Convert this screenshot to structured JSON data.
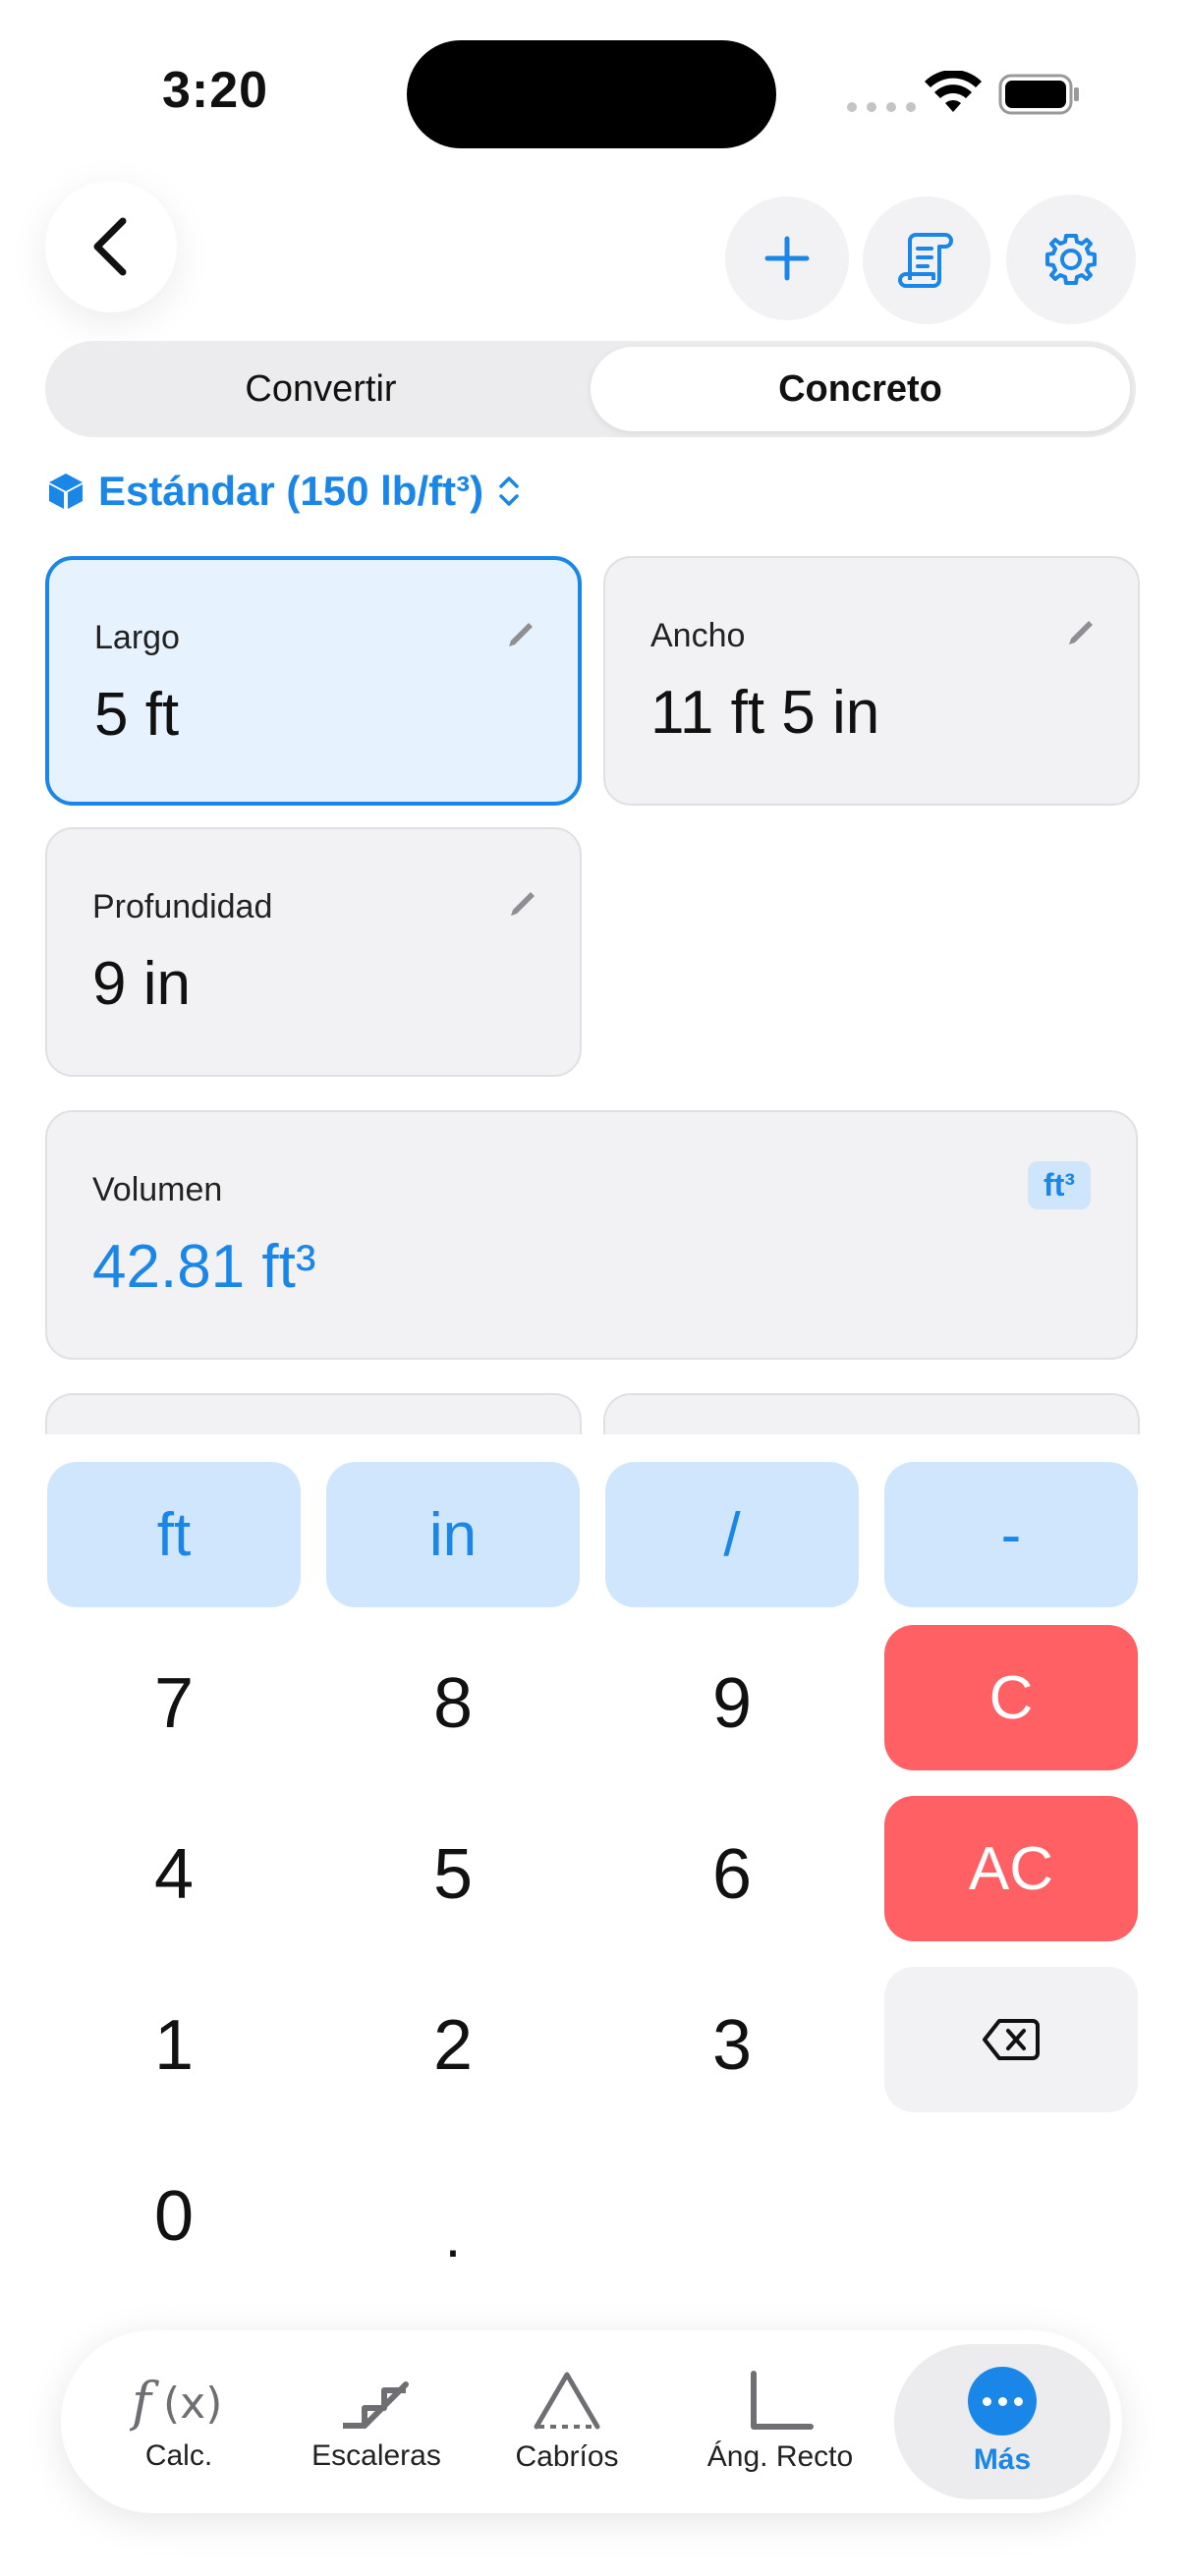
{
  "status_bar": {
    "time": "3:20"
  },
  "header": {
    "back_icon": "chevron-left-icon",
    "add_icon": "plus-icon",
    "list_icon": "scroll-list-icon",
    "settings_icon": "gear-icon"
  },
  "segmented": {
    "options": [
      {
        "label": "Convertir",
        "selected": false
      },
      {
        "label": "Concreto",
        "selected": true
      }
    ]
  },
  "density": {
    "label": "Estándar (150 lb/ft³)",
    "icon": "cube-icon"
  },
  "inputs": {
    "largo": {
      "label": "Largo",
      "value": "5 ft",
      "selected": true
    },
    "ancho": {
      "label": "Ancho",
      "value": "11 ft 5 in"
    },
    "profundidad": {
      "label": "Profundidad",
      "value": "9 in"
    }
  },
  "result": {
    "label": "Volumen",
    "value": "42.81 ft³",
    "unit": "ft³"
  },
  "keypad": {
    "units": [
      "ft",
      "in",
      "/",
      "-"
    ],
    "digits": [
      "7",
      "8",
      "9",
      "4",
      "5",
      "6",
      "1",
      "2",
      "3",
      "0",
      "."
    ],
    "clear": "C",
    "all_clear": "AC"
  },
  "tabbar": {
    "items": [
      {
        "label": "Calc.",
        "icon": "function-icon"
      },
      {
        "label": "Escaleras",
        "icon": "stairs-icon"
      },
      {
        "label": "Cabríos",
        "icon": "rafter-triangle-icon"
      },
      {
        "label": "Áng. Recto",
        "icon": "right-angle-icon"
      },
      {
        "label": "Más",
        "icon": "more-icon",
        "active": true
      }
    ]
  },
  "colors": {
    "accent": "#1a86e8",
    "danger": "#fe6064",
    "unit_key": "#cfe6fc"
  }
}
